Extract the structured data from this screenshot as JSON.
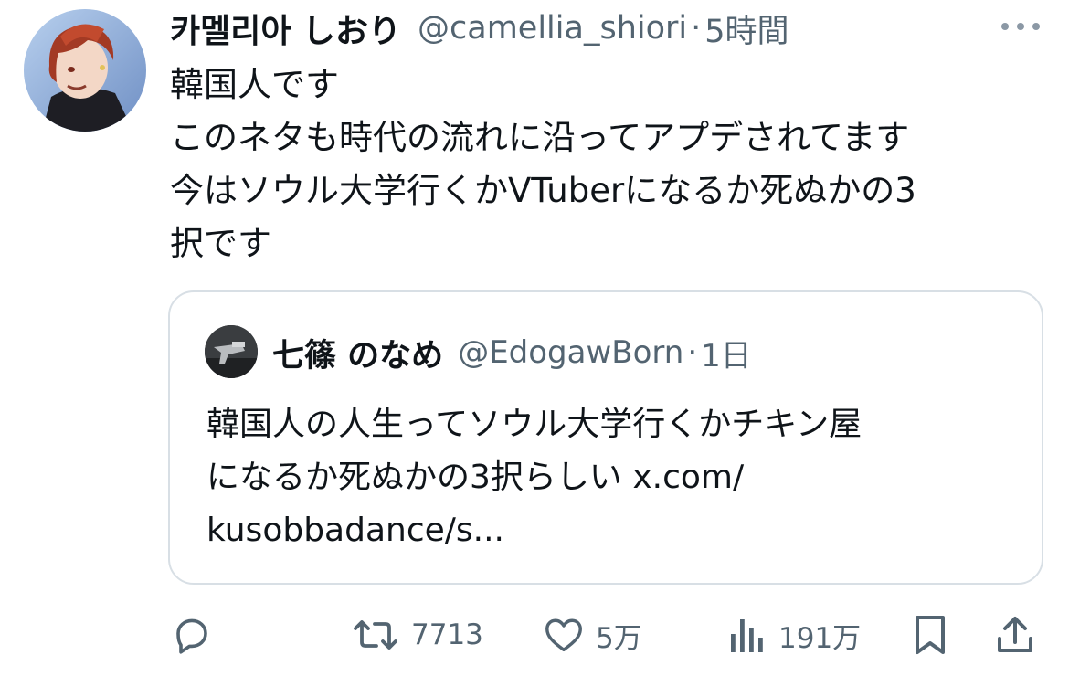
{
  "tweet": {
    "author_name": "카멜리아 しおり",
    "handle": "@camellia_shiori",
    "separator": "·",
    "time": "5時間",
    "text_lines": [
      "韓国人です",
      "このネタも時代の流れに沿ってアプデされてます",
      "今はソウル大学行くかVTuberになるか死ぬかの3",
      "択です"
    ]
  },
  "quote": {
    "author_name": "七篠 のなめ",
    "handle": "@EdogawBorn",
    "separator": "·",
    "time": "1日",
    "text_lines": [
      "韓国人の人生ってソウル大学行くかチキン屋",
      "になるか死ぬかの3択らしい x.com/",
      "kusobbadance/s..."
    ]
  },
  "actions": {
    "reply": {
      "icon": "reply-icon"
    },
    "retweet": {
      "icon": "retweet-icon",
      "count": "7713"
    },
    "like": {
      "icon": "heart-icon",
      "count": "5万"
    },
    "views": {
      "icon": "views-chart-icon",
      "count": "191万"
    },
    "bookmark": {
      "icon": "bookmark-icon"
    },
    "share": {
      "icon": "share-icon"
    }
  },
  "colors": {
    "text": "#0f1419",
    "muted": "#536471",
    "border": "#d8dfe5",
    "icon": "#536471"
  }
}
